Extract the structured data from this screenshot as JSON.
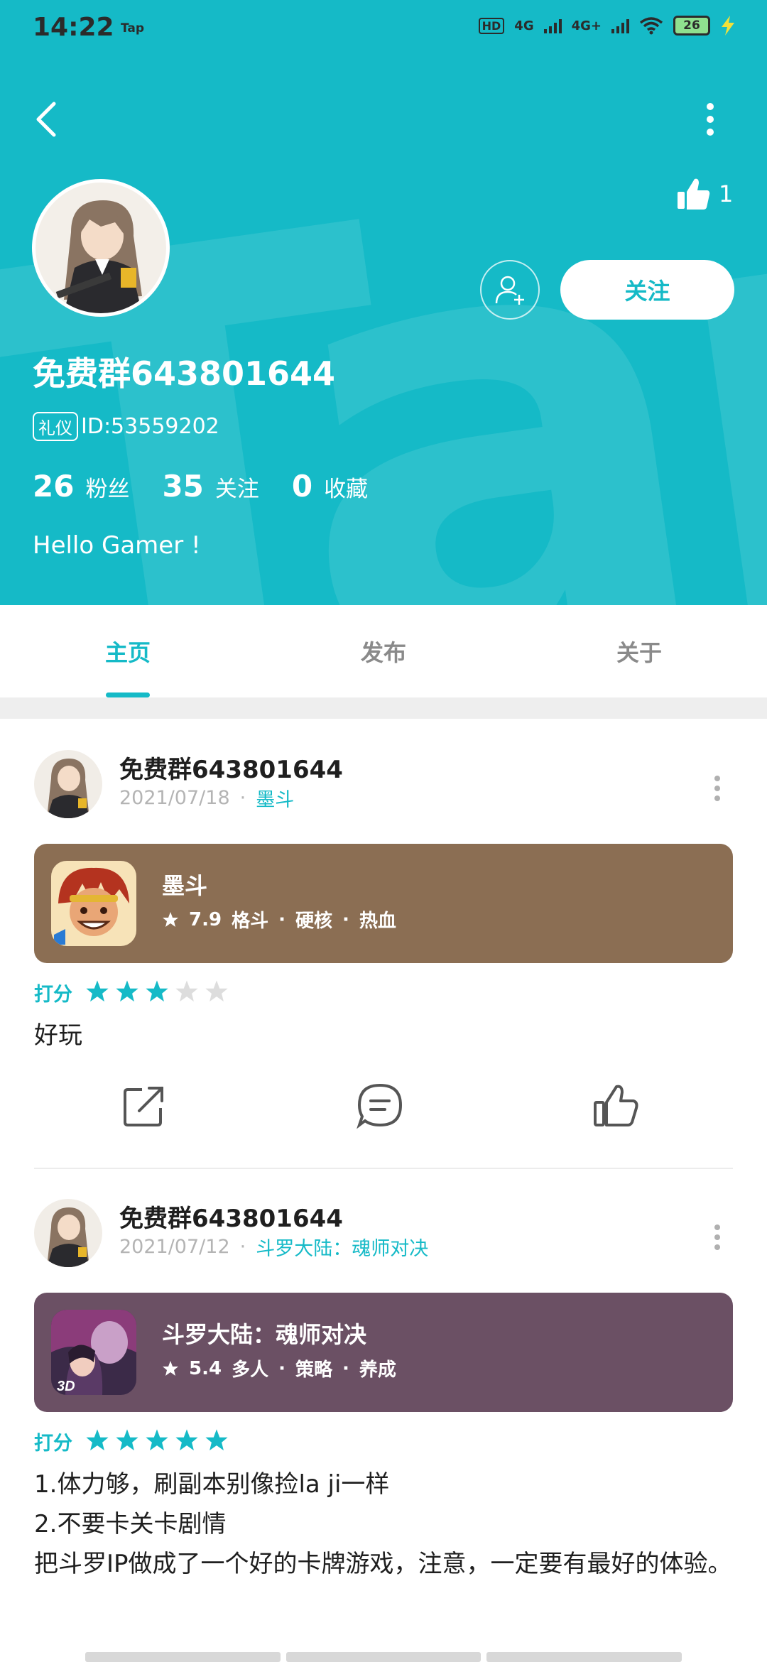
{
  "status_bar": {
    "time": "14:22",
    "carrier": "Tap",
    "network_hd": "HD",
    "network_1": "4G",
    "network_2": "4G+",
    "battery": "26"
  },
  "header": {
    "watermark": "TapTap",
    "like_count": "1",
    "follow_label": "关注",
    "username": "免费群643801644",
    "id_badge": "礼仪",
    "id_text": "ID:53559202",
    "stats": [
      {
        "num": "26",
        "label": "粉丝"
      },
      {
        "num": "35",
        "label": "关注"
      },
      {
        "num": "0",
        "label": "收藏"
      }
    ],
    "bio": "Hello Gamer !"
  },
  "tabs": [
    {
      "label": "主页",
      "active": true
    },
    {
      "label": "发布",
      "active": false
    },
    {
      "label": "关于",
      "active": false
    }
  ],
  "posts": [
    {
      "author": "免费群643801644",
      "date": "2021/07/18",
      "game_link": "墨斗",
      "game": {
        "title": "墨斗",
        "score": "7.9",
        "tags": [
          "格斗",
          "硬核",
          "热血"
        ],
        "card_color": "#8b6e53"
      },
      "rating_label": "打分",
      "stars": 3,
      "review_lines": [
        "好玩"
      ]
    },
    {
      "author": "免费群643801644",
      "date": "2021/07/12",
      "game_link": "斗罗大陆：魂师对决",
      "game": {
        "title": "斗罗大陆：魂师对决",
        "score": "5.4",
        "tags": [
          "多人",
          "策略",
          "养成"
        ],
        "card_color": "#6b5064"
      },
      "rating_label": "打分",
      "stars": 5,
      "review_lines": [
        "1.体力够，刷副本别像捡la ji一样",
        "2.不要卡关卡剧情",
        "把斗罗IP做成了一个好的卡牌游戏，注意，一定要有最好的体验。"
      ]
    }
  ],
  "colors": {
    "accent": "#15bac7",
    "star_on": "#15bac7",
    "star_off": "#dddddd"
  }
}
